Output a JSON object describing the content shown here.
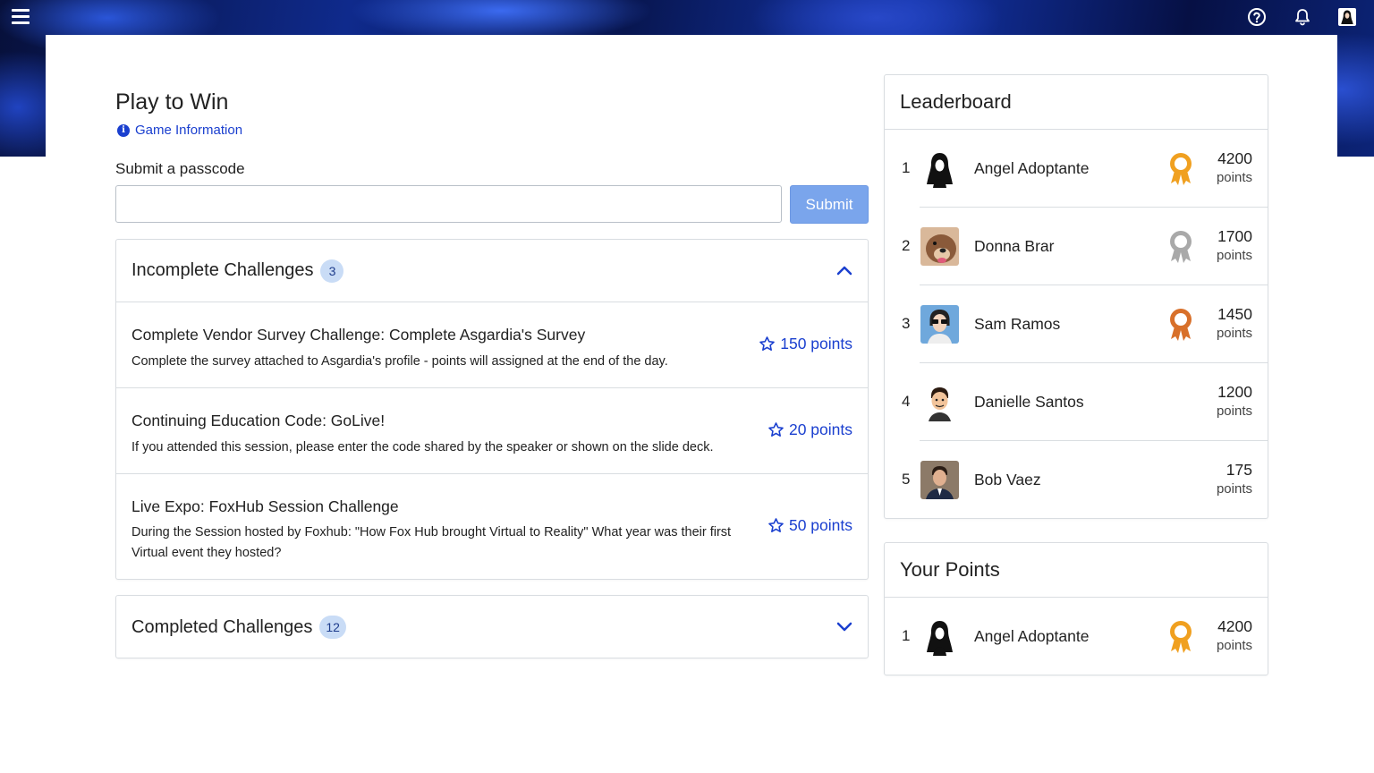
{
  "colors": {
    "accent": "#1a3fcf",
    "submit_bg": "#7aa5ec",
    "badge_bg": "#c9dcf6",
    "gold": "#f0a020",
    "silver": "#a9a9a9",
    "bronze": "#d8702a"
  },
  "header": {
    "menu_icon": "hamburger-menu-icon",
    "help_icon": "help-circle-icon",
    "bell_icon": "bell-icon",
    "profile_icon": "user-avatar-icon"
  },
  "main": {
    "title": "Play to Win",
    "game_info_icon": "info-icon",
    "game_info_label": "Game Information",
    "passcode_label": "Submit a passcode",
    "passcode_value": "",
    "submit_label": "Submit"
  },
  "incomplete": {
    "title": "Incomplete Challenges",
    "count": "3",
    "expanded": true,
    "items": [
      {
        "title": "Complete Vendor Survey Challenge: Complete Asgardia's Survey",
        "desc": "Complete the survey attached to Asgardia's profile - points will assigned at the end of the day.",
        "points": "150 points"
      },
      {
        "title": "Continuing Education Code: GoLive!",
        "desc": "If you attended this session, please enter the code shared by the speaker or shown on the slide deck.",
        "points": "20 points"
      },
      {
        "title": "Live Expo: FoxHub Session Challenge",
        "desc": "During the Session hosted by Foxhub: \"How Fox Hub brought Virtual to Reality\" What year was their first Virtual event they hosted?",
        "points": "50 points"
      }
    ]
  },
  "completed": {
    "title": "Completed Challenges",
    "count": "12",
    "expanded": false
  },
  "leaderboard": {
    "title": "Leaderboard",
    "rows": [
      {
        "rank": "1",
        "name": "Angel Adoptante",
        "points": "4200",
        "unit": "points",
        "medal": "gold"
      },
      {
        "rank": "2",
        "name": "Donna Brar",
        "points": "1700",
        "unit": "points",
        "medal": "silver"
      },
      {
        "rank": "3",
        "name": "Sam Ramos",
        "points": "1450",
        "unit": "points",
        "medal": "bronze"
      },
      {
        "rank": "4",
        "name": "Danielle Santos",
        "points": "1200",
        "unit": "points",
        "medal": ""
      },
      {
        "rank": "5",
        "name": "Bob Vaez",
        "points": "175",
        "unit": "points",
        "medal": ""
      }
    ]
  },
  "your_points": {
    "title": "Your Points",
    "row": {
      "rank": "1",
      "name": "Angel Adoptante",
      "points": "4200",
      "unit": "points",
      "medal": "gold"
    }
  }
}
